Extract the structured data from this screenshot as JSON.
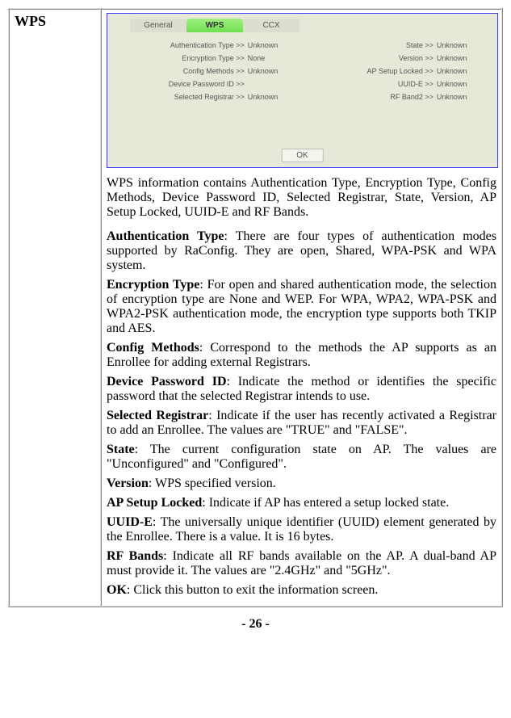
{
  "label": "WPS",
  "screenshot": {
    "tabs": [
      "General",
      "WPS",
      "CCX"
    ],
    "activeTab": 1,
    "left": [
      {
        "label": "Authentication Type >>",
        "val": "Unknown"
      },
      {
        "label": "Encryption Type >>",
        "val": "None"
      },
      {
        "label": "Config Methods >>",
        "val": "Unknown"
      },
      {
        "label": "Device Password ID >>",
        "val": ""
      },
      {
        "label": "Selected Registrar >>",
        "val": "Unknown"
      }
    ],
    "right": [
      {
        "label": "State >>",
        "val": "Unknown"
      },
      {
        "label": "Version >>",
        "val": "Unknown"
      },
      {
        "label": "AP Setup Locked >>",
        "val": "Unknown"
      },
      {
        "label": "UUID-E >>",
        "val": "Unknown"
      },
      {
        "label": "RF Band2 >>",
        "val": "Unknown"
      }
    ],
    "okLabel": "OK"
  },
  "intro": "WPS information contains Authentication Type, Encryption Type, Config Methods, Device Password ID, Selected Registrar, State, Version, AP Setup Locked, UUID-E and RF Bands.",
  "defs": [
    {
      "term": "Authentication Type",
      "text": ": There are four types of authentication modes supported by RaConfig. They are open, Shared, WPA-PSK and WPA system."
    },
    {
      "term": "Encryption Type",
      "text": ": For open and shared authentication mode, the selection of encryption type are None and WEP. For WPA, WPA2, WPA-PSK and WPA2-PSK authentication mode, the encryption type supports both TKIP and AES."
    },
    {
      "term": "Config Methods",
      "text": ": Correspond to the methods the AP supports as an Enrollee for adding external Registrars."
    },
    {
      "term": "Device Password ID",
      "text": ": Indicate the method or identifies the specific password that the selected Registrar intends to use."
    },
    {
      "term": "Selected Registrar",
      "text": ": Indicate if the user has recently activated a Registrar to add an Enrollee. The values are \"TRUE\" and \"FALSE\"."
    },
    {
      "term": "State",
      "text": ": The current configuration state on AP. The values are \"Unconfigured\" and \"Configured\"."
    },
    {
      "term": "Version",
      "text": ": WPS specified version."
    },
    {
      "term": "AP Setup Locked",
      "text": ": Indicate if AP has entered a setup locked state."
    },
    {
      "term": "UUID-E",
      "text": ": The universally unique identifier (UUID) element generated by the Enrollee. There is a value. It is 16 bytes."
    },
    {
      "term": "RF Bands",
      "text": ": Indicate all RF bands available on the AP. A dual-band AP must provide it. The values are \"2.4GHz\" and \"5GHz\"."
    },
    {
      "term": "OK",
      "text": ": Click this button to exit the information screen."
    }
  ],
  "footer": "- 26 -"
}
